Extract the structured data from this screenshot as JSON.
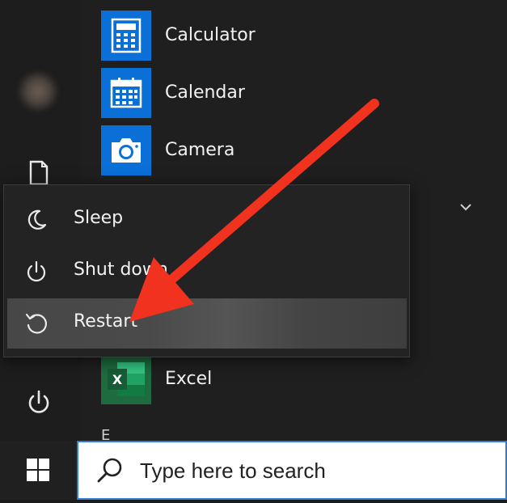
{
  "apps": [
    {
      "label": "Calculator",
      "icon": "calculator-icon"
    },
    {
      "label": "Calendar",
      "icon": "calendar-icon"
    },
    {
      "label": "Camera",
      "icon": "camera-icon"
    },
    {
      "label": "Excel",
      "icon": "excel-icon"
    }
  ],
  "section_letter": "E",
  "power_menu": {
    "items": [
      {
        "label": "Sleep",
        "icon": "moon-icon"
      },
      {
        "label": "Shut down",
        "icon": "power-icon"
      },
      {
        "label": "Restart",
        "icon": "restart-icon",
        "highlighted": true
      }
    ]
  },
  "taskbar": {
    "search_placeholder": "Type here to search"
  },
  "colors": {
    "tile_blue": "#0a6fd6",
    "excel_green": "#1e6b3f",
    "annotation_arrow": "#f0321e",
    "search_border": "#2f7dd1"
  }
}
